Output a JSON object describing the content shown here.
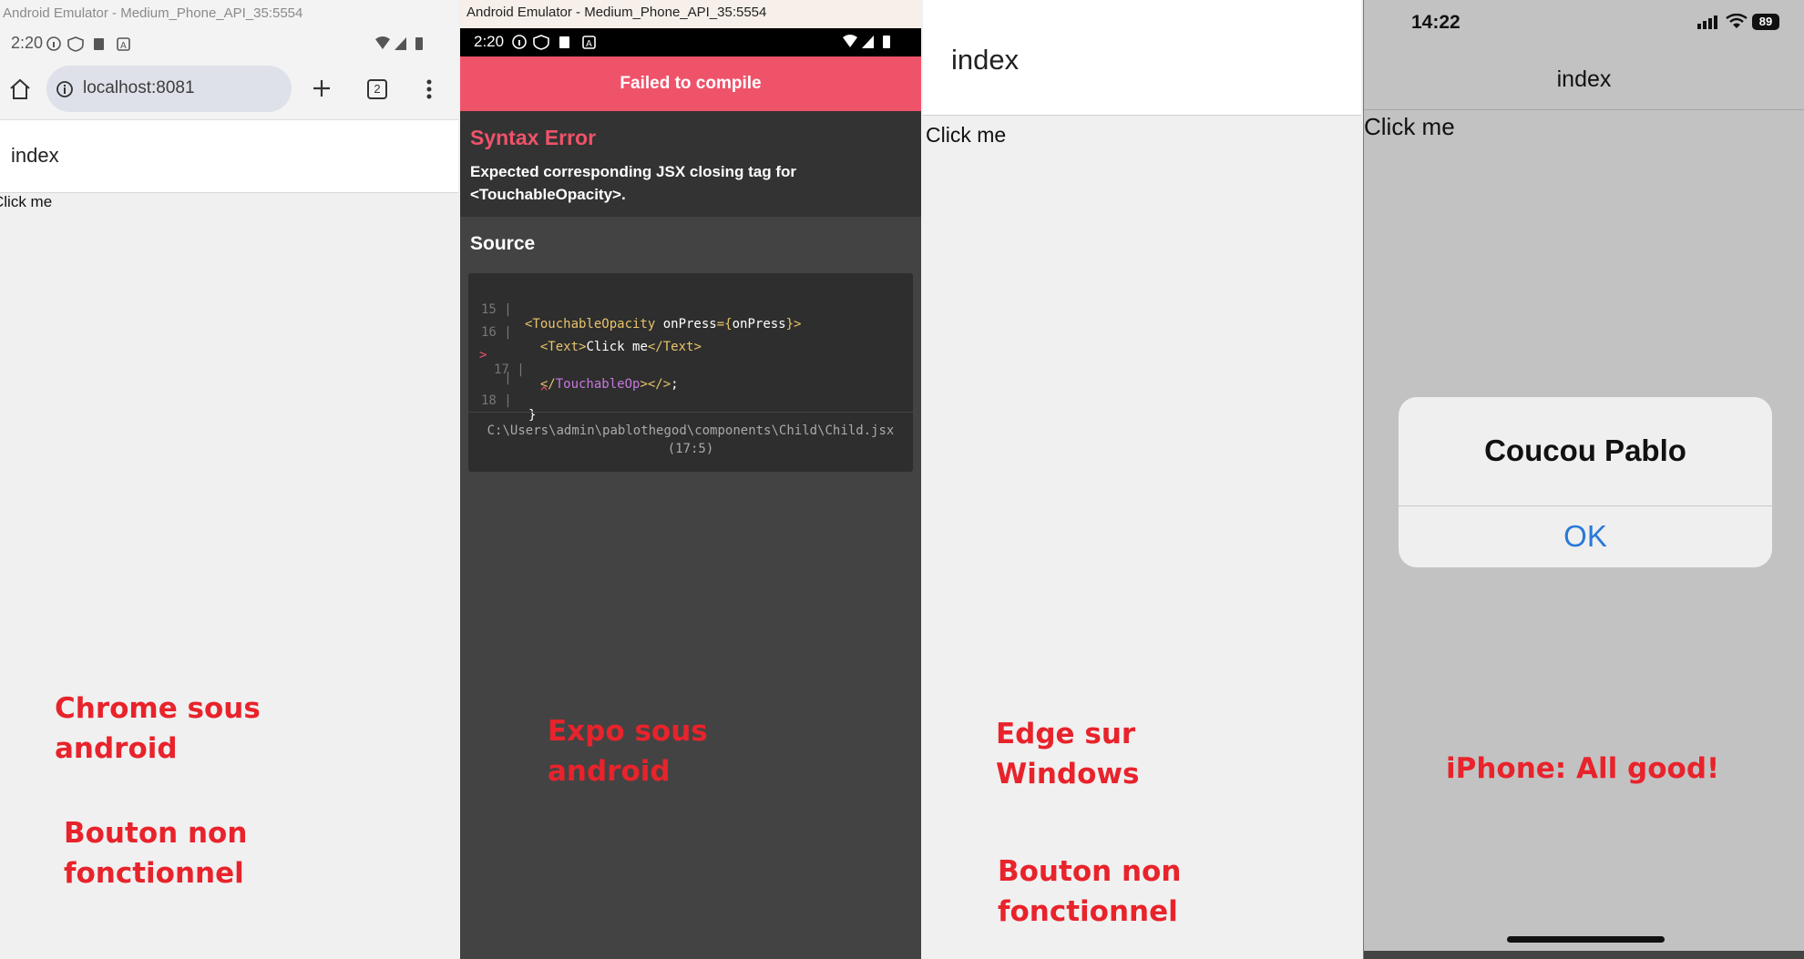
{
  "panels": {
    "chrome_android": {
      "window_title": "Android Emulator - Medium_Phone_API_35:5554",
      "status_time": "2:20",
      "url": "localhost:8081",
      "tab_count": "2",
      "page_title": "index",
      "button_text": "Click me",
      "caption": "Chrome sous android",
      "caption2": "Bouton non fonctionnel"
    },
    "expo_android": {
      "window_title": "Android Emulator - Medium_Phone_API_35:5554",
      "status_time": "2:20",
      "error_banner": "Failed to compile",
      "error_title": "Syntax Error",
      "error_message": "Expected corresponding JSX closing tag for <TouchableOpacity>.",
      "source_label": "Source",
      "code_lines": [
        {
          "marker": "",
          "num": "15",
          "text": "<TouchableOpacity onPress={onPress}>"
        },
        {
          "marker": "",
          "num": "16",
          "text": "  <Text>Click me</Text>"
        },
        {
          "marker": ">",
          "num": "17",
          "text": "  </TouchableOp></>;"
        },
        {
          "marker": "",
          "num": "",
          "text": "  ^"
        },
        {
          "marker": "",
          "num": "18",
          "text": "}"
        }
      ],
      "file_path": "C:\\Users\\admin\\pablothegod\\components\\Child\\Child.jsx",
      "file_position": "(17:5)",
      "caption": "Expo sous android"
    },
    "edge_windows": {
      "page_title": "index",
      "button_text": "Click me",
      "caption": "Edge sur Windows",
      "caption2": "Bouton non fonctionnel"
    },
    "iphone": {
      "status_time": "14:22",
      "battery": "89",
      "page_title": "index",
      "button_text": "Click me",
      "alert_title": "Coucou Pablo",
      "alert_button": "OK",
      "caption": "iPhone: All good!"
    }
  },
  "colors": {
    "caption_red": "#e8232b",
    "expo_error_pink": "#ef536a",
    "ios_blue": "#2979d8"
  }
}
